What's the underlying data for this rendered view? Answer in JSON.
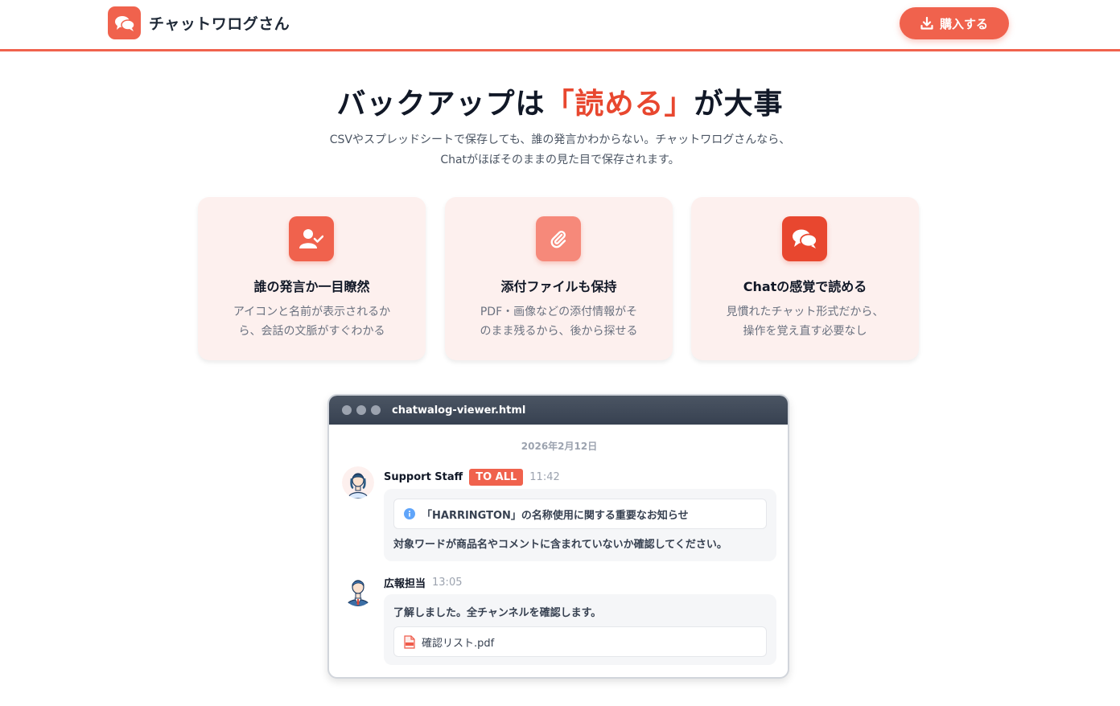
{
  "header": {
    "app_name": "チャットワログさん",
    "buy_label": "購入する",
    "colors": {
      "accent": "#f0624d"
    }
  },
  "hero": {
    "title_before": "バックアップは",
    "title_accent": "「読める」",
    "title_after": "が大事",
    "subtitle_line1": "CSVやスプレッドシートで保存しても、誰の発言かわからない。チャットワログさんなら、",
    "subtitle_line2": "Chatがほぼそのままの見た目で保存されます。"
  },
  "features": [
    {
      "icon": "user-check-icon",
      "title": "誰の発言か一目瞭然",
      "desc_line1": "アイコンと名前が表示されるか",
      "desc_line2": "ら、会話の文脈がすぐわかる"
    },
    {
      "icon": "paperclip-icon",
      "title": "添付ファイルも保持",
      "desc_line1": "PDF・画像などの添付情報がそ",
      "desc_line2": "のまま残るから、後から探せる"
    },
    {
      "icon": "chat-bubbles-icon",
      "title": "Chatの感覚で読める",
      "desc_line1": "見慣れたチャット形式だから、",
      "desc_line2": "操作を覚え直す必要なし"
    }
  ],
  "viewer": {
    "filename": "chatwalog-viewer.html",
    "date": "2026年2月12日",
    "messages": [
      {
        "sender": "Support Staff",
        "badge": "TO ALL",
        "time": "11:42",
        "notice": "「HARRINGTON」の名称使用に関する重要なお知らせ",
        "text": "対象ワードが商品名やコメントに含まれていないか確認してください。"
      },
      {
        "sender": "広報担当",
        "time": "13:05",
        "text": "了解しました。全チャンネルを確認します。",
        "attachment": "確認リスト.pdf"
      }
    ]
  }
}
